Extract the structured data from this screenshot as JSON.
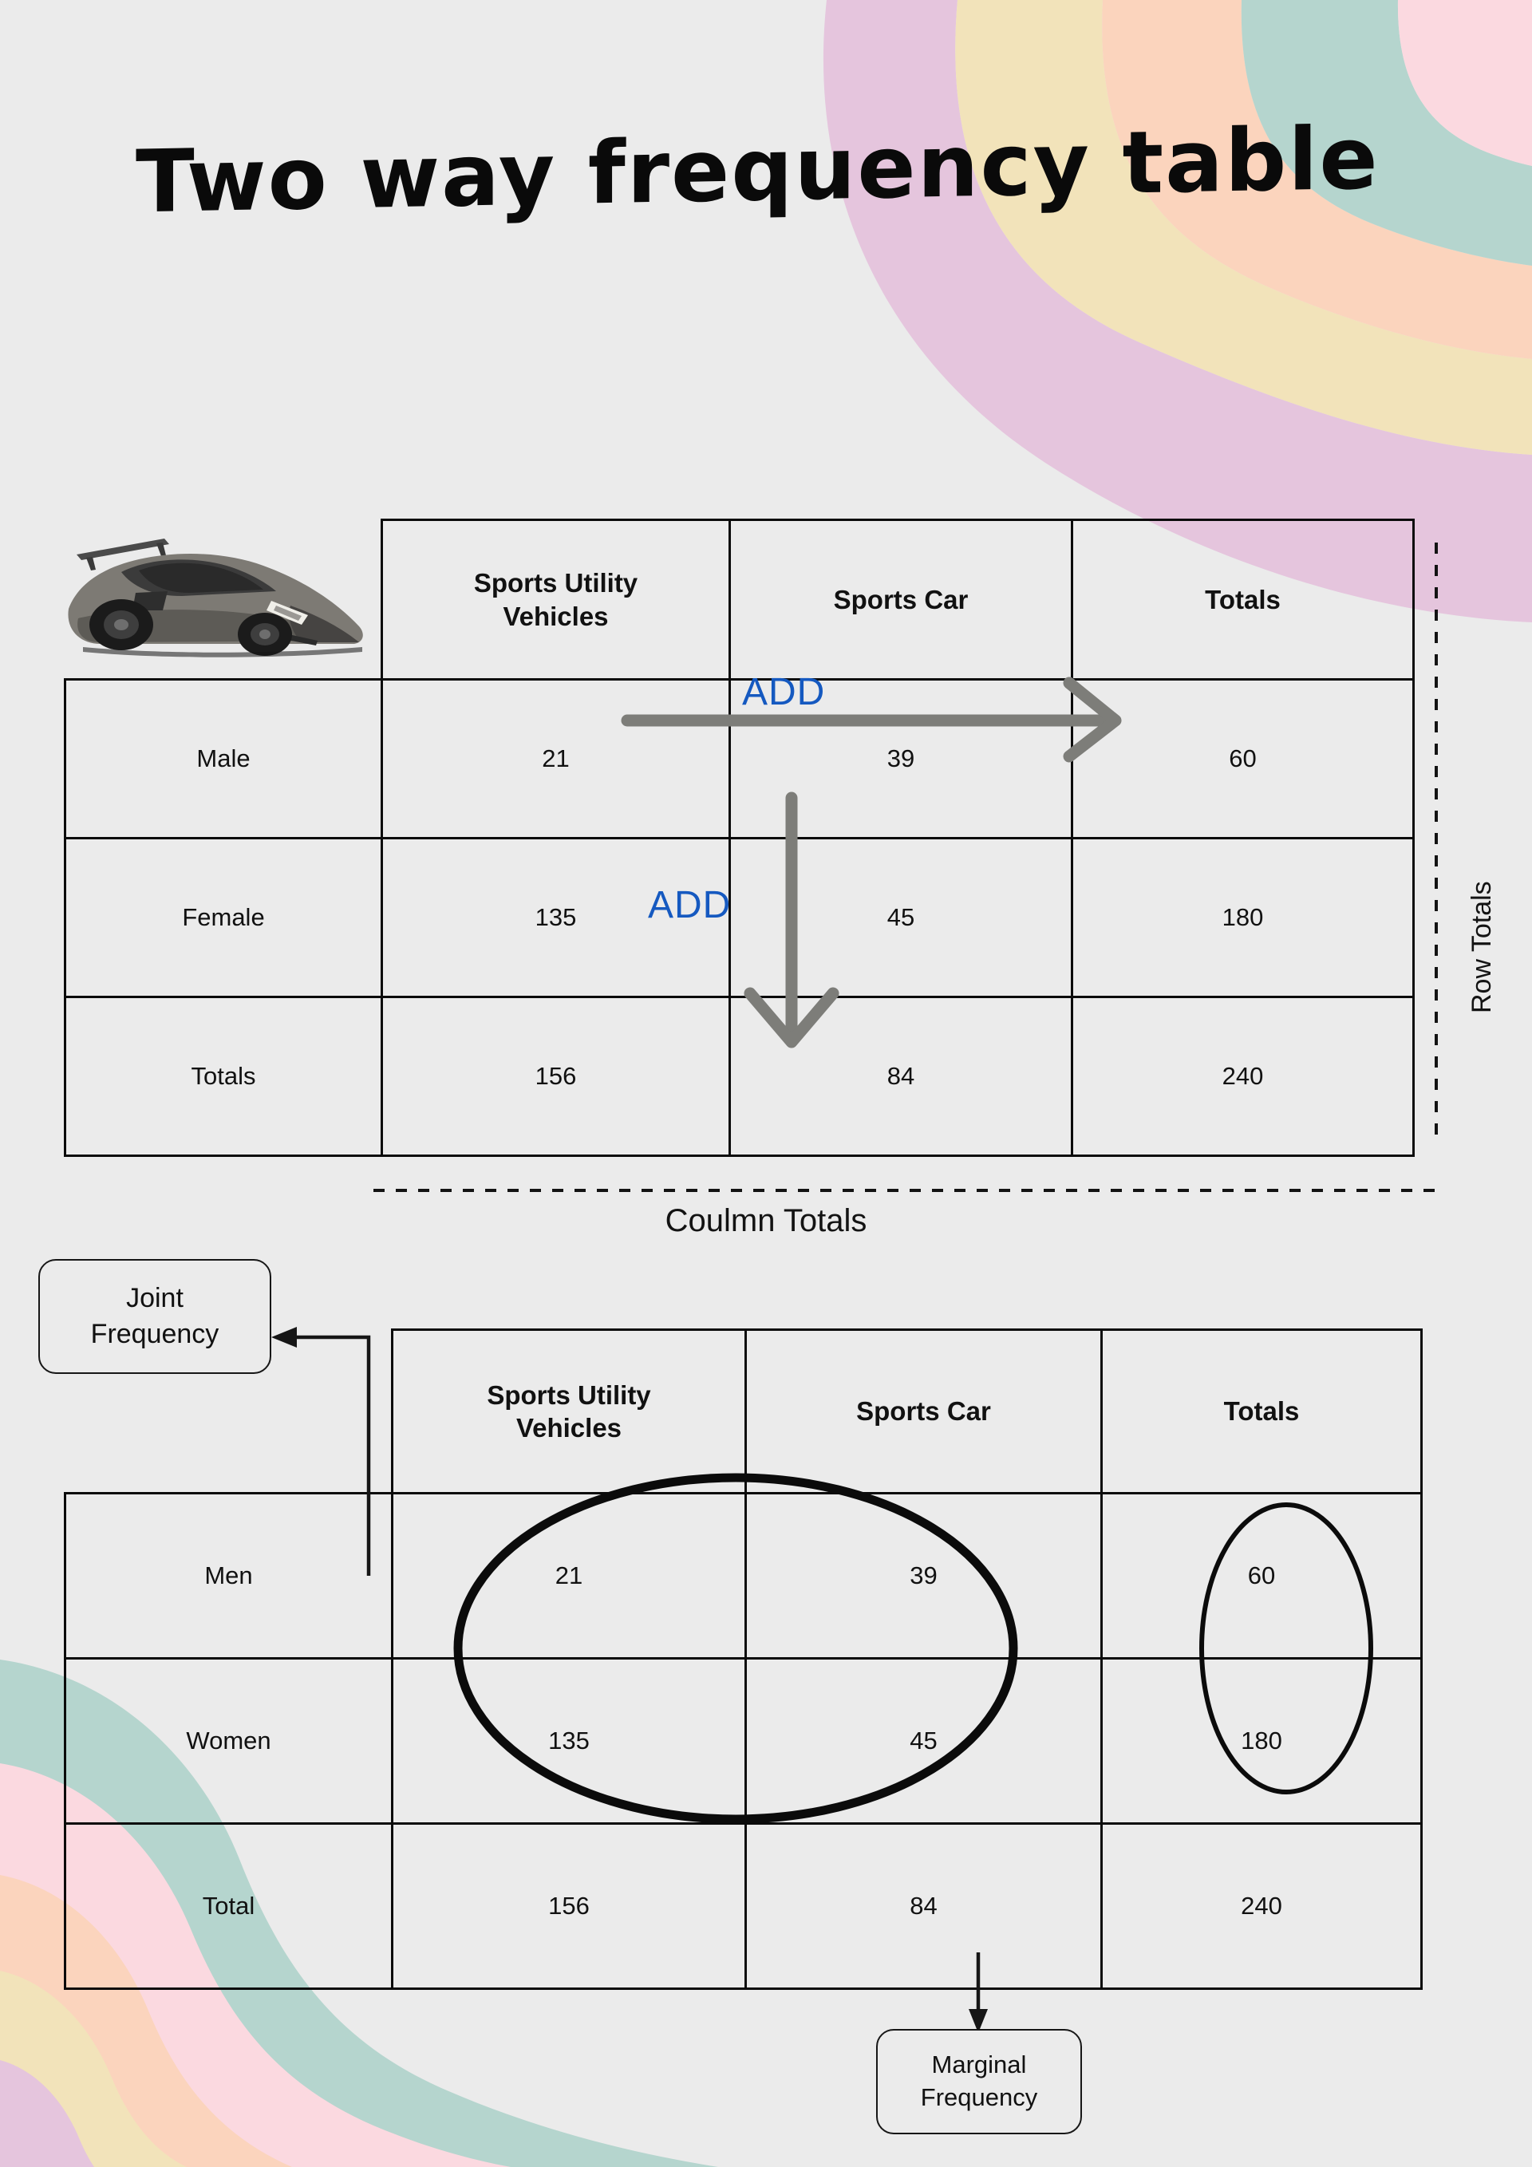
{
  "title": "Two way frequency table",
  "colors": {
    "background": "#ebebeb",
    "ink": "#0d0d0d",
    "add_blue": "#1559c0",
    "arrow_gray": "#7d7d79",
    "wave_mauve": "#e5c5dd",
    "wave_yellow": "#f2e3ba",
    "wave_peach": "#fbd4bd",
    "wave_teal": "#b5d5ce",
    "wave_pink": "#fbd9e0"
  },
  "icons": {
    "car": "sports-car-icon",
    "arrow_right": "arrow-right-icon",
    "arrow_down": "arrow-down-icon",
    "ellipse_joint": "ellipse-highlight-icon",
    "ellipse_marginal": "ellipse-highlight-icon"
  },
  "annotations": {
    "add_row": "ADD",
    "add_column": "ADD",
    "row_totals": "Row Totals",
    "column_totals": "Coulmn Totals",
    "joint_frequency": "Joint\nFrequency",
    "joint_frequency_line1": "Joint",
    "joint_frequency_line2": "Frequency",
    "marginal_frequency_line1": "Marginal",
    "marginal_frequency_line2": "Frequency"
  },
  "chart_data": {
    "type": "table",
    "title": "Two way frequency table",
    "tables": [
      {
        "id": "table-1",
        "corner": "",
        "columns": [
          "Sports Utility Vehicles",
          "Sports  Car",
          "Totals"
        ],
        "rows": [
          {
            "label": "Male",
            "values": [
              21,
              39,
              60
            ]
          },
          {
            "label": "Female",
            "values": [
              135,
              45,
              180
            ]
          },
          {
            "label": "Totals",
            "values": [
              156,
              84,
              240
            ]
          }
        ],
        "annotations": [
          "ADD",
          "ADD",
          "Row Totals",
          "Coulmn Totals"
        ]
      },
      {
        "id": "table-2",
        "corner": "",
        "columns": [
          "Sports Utility Vehicles",
          "Sports  Car",
          "Totals"
        ],
        "rows": [
          {
            "label": "Men",
            "values": [
              21,
              39,
              60
            ]
          },
          {
            "label": "Women",
            "values": [
              135,
              45,
              180
            ]
          },
          {
            "label": "Total",
            "values": [
              156,
              84,
              240
            ]
          }
        ],
        "annotations": [
          "Joint Frequency",
          "Marginal Frequency"
        ]
      }
    ]
  },
  "table1": {
    "corner": "",
    "h_suv": "Sports Utility Vehicles",
    "h_suv_l1": "Sports Utility",
    "h_suv_l2": "Vehicles",
    "h_sports_car": "Sports  Car",
    "h_totals": "Totals",
    "r1_label": "Male",
    "r1_suv": "21",
    "r1_car": "39",
    "r1_tot": "60",
    "r2_label": "Female",
    "r2_suv": "135",
    "r2_car": "45",
    "r2_tot": "180",
    "r3_label": "Totals",
    "r3_suv": "156",
    "r3_car": "84",
    "r3_tot": "240"
  },
  "table2": {
    "corner": "",
    "h_suv_l1": "Sports Utility",
    "h_suv_l2": "Vehicles",
    "h_sports_car": "Sports  Car",
    "h_totals": "Totals",
    "r1_label": "Men",
    "r1_suv": "21",
    "r1_car": "39",
    "r1_tot": "60",
    "r2_label": "Women",
    "r2_suv": "135",
    "r2_car": "45",
    "r2_tot": "180",
    "r3_label": "Total",
    "r3_suv": "156",
    "r3_car": "84",
    "r3_tot": "240"
  }
}
